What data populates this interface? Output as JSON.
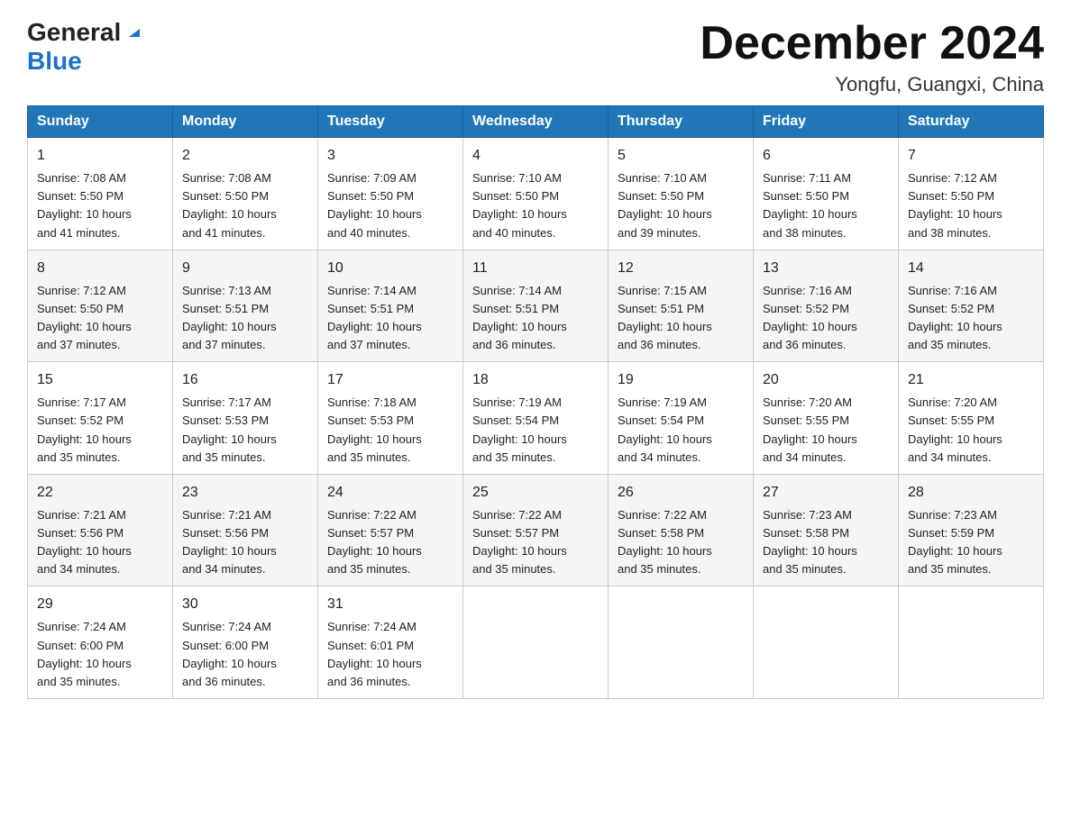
{
  "logo": {
    "general": "General",
    "blue": "Blue"
  },
  "header": {
    "title": "December 2024",
    "location": "Yongfu, Guangxi, China"
  },
  "days_of_week": [
    "Sunday",
    "Monday",
    "Tuesday",
    "Wednesday",
    "Thursday",
    "Friday",
    "Saturday"
  ],
  "weeks": [
    [
      {
        "day": "1",
        "sunrise": "7:08 AM",
        "sunset": "5:50 PM",
        "daylight": "10 hours and 41 minutes."
      },
      {
        "day": "2",
        "sunrise": "7:08 AM",
        "sunset": "5:50 PM",
        "daylight": "10 hours and 41 minutes."
      },
      {
        "day": "3",
        "sunrise": "7:09 AM",
        "sunset": "5:50 PM",
        "daylight": "10 hours and 40 minutes."
      },
      {
        "day": "4",
        "sunrise": "7:10 AM",
        "sunset": "5:50 PM",
        "daylight": "10 hours and 40 minutes."
      },
      {
        "day": "5",
        "sunrise": "7:10 AM",
        "sunset": "5:50 PM",
        "daylight": "10 hours and 39 minutes."
      },
      {
        "day": "6",
        "sunrise": "7:11 AM",
        "sunset": "5:50 PM",
        "daylight": "10 hours and 38 minutes."
      },
      {
        "day": "7",
        "sunrise": "7:12 AM",
        "sunset": "5:50 PM",
        "daylight": "10 hours and 38 minutes."
      }
    ],
    [
      {
        "day": "8",
        "sunrise": "7:12 AM",
        "sunset": "5:50 PM",
        "daylight": "10 hours and 37 minutes."
      },
      {
        "day": "9",
        "sunrise": "7:13 AM",
        "sunset": "5:51 PM",
        "daylight": "10 hours and 37 minutes."
      },
      {
        "day": "10",
        "sunrise": "7:14 AM",
        "sunset": "5:51 PM",
        "daylight": "10 hours and 37 minutes."
      },
      {
        "day": "11",
        "sunrise": "7:14 AM",
        "sunset": "5:51 PM",
        "daylight": "10 hours and 36 minutes."
      },
      {
        "day": "12",
        "sunrise": "7:15 AM",
        "sunset": "5:51 PM",
        "daylight": "10 hours and 36 minutes."
      },
      {
        "day": "13",
        "sunrise": "7:16 AM",
        "sunset": "5:52 PM",
        "daylight": "10 hours and 36 minutes."
      },
      {
        "day": "14",
        "sunrise": "7:16 AM",
        "sunset": "5:52 PM",
        "daylight": "10 hours and 35 minutes."
      }
    ],
    [
      {
        "day": "15",
        "sunrise": "7:17 AM",
        "sunset": "5:52 PM",
        "daylight": "10 hours and 35 minutes."
      },
      {
        "day": "16",
        "sunrise": "7:17 AM",
        "sunset": "5:53 PM",
        "daylight": "10 hours and 35 minutes."
      },
      {
        "day": "17",
        "sunrise": "7:18 AM",
        "sunset": "5:53 PM",
        "daylight": "10 hours and 35 minutes."
      },
      {
        "day": "18",
        "sunrise": "7:19 AM",
        "sunset": "5:54 PM",
        "daylight": "10 hours and 35 minutes."
      },
      {
        "day": "19",
        "sunrise": "7:19 AM",
        "sunset": "5:54 PM",
        "daylight": "10 hours and 34 minutes."
      },
      {
        "day": "20",
        "sunrise": "7:20 AM",
        "sunset": "5:55 PM",
        "daylight": "10 hours and 34 minutes."
      },
      {
        "day": "21",
        "sunrise": "7:20 AM",
        "sunset": "5:55 PM",
        "daylight": "10 hours and 34 minutes."
      }
    ],
    [
      {
        "day": "22",
        "sunrise": "7:21 AM",
        "sunset": "5:56 PM",
        "daylight": "10 hours and 34 minutes."
      },
      {
        "day": "23",
        "sunrise": "7:21 AM",
        "sunset": "5:56 PM",
        "daylight": "10 hours and 34 minutes."
      },
      {
        "day": "24",
        "sunrise": "7:22 AM",
        "sunset": "5:57 PM",
        "daylight": "10 hours and 35 minutes."
      },
      {
        "day": "25",
        "sunrise": "7:22 AM",
        "sunset": "5:57 PM",
        "daylight": "10 hours and 35 minutes."
      },
      {
        "day": "26",
        "sunrise": "7:22 AM",
        "sunset": "5:58 PM",
        "daylight": "10 hours and 35 minutes."
      },
      {
        "day": "27",
        "sunrise": "7:23 AM",
        "sunset": "5:58 PM",
        "daylight": "10 hours and 35 minutes."
      },
      {
        "day": "28",
        "sunrise": "7:23 AM",
        "sunset": "5:59 PM",
        "daylight": "10 hours and 35 minutes."
      }
    ],
    [
      {
        "day": "29",
        "sunrise": "7:24 AM",
        "sunset": "6:00 PM",
        "daylight": "10 hours and 35 minutes."
      },
      {
        "day": "30",
        "sunrise": "7:24 AM",
        "sunset": "6:00 PM",
        "daylight": "10 hours and 36 minutes."
      },
      {
        "day": "31",
        "sunrise": "7:24 AM",
        "sunset": "6:01 PM",
        "daylight": "10 hours and 36 minutes."
      },
      null,
      null,
      null,
      null
    ]
  ],
  "labels": {
    "sunrise": "Sunrise:",
    "sunset": "Sunset:",
    "daylight": "Daylight:"
  }
}
